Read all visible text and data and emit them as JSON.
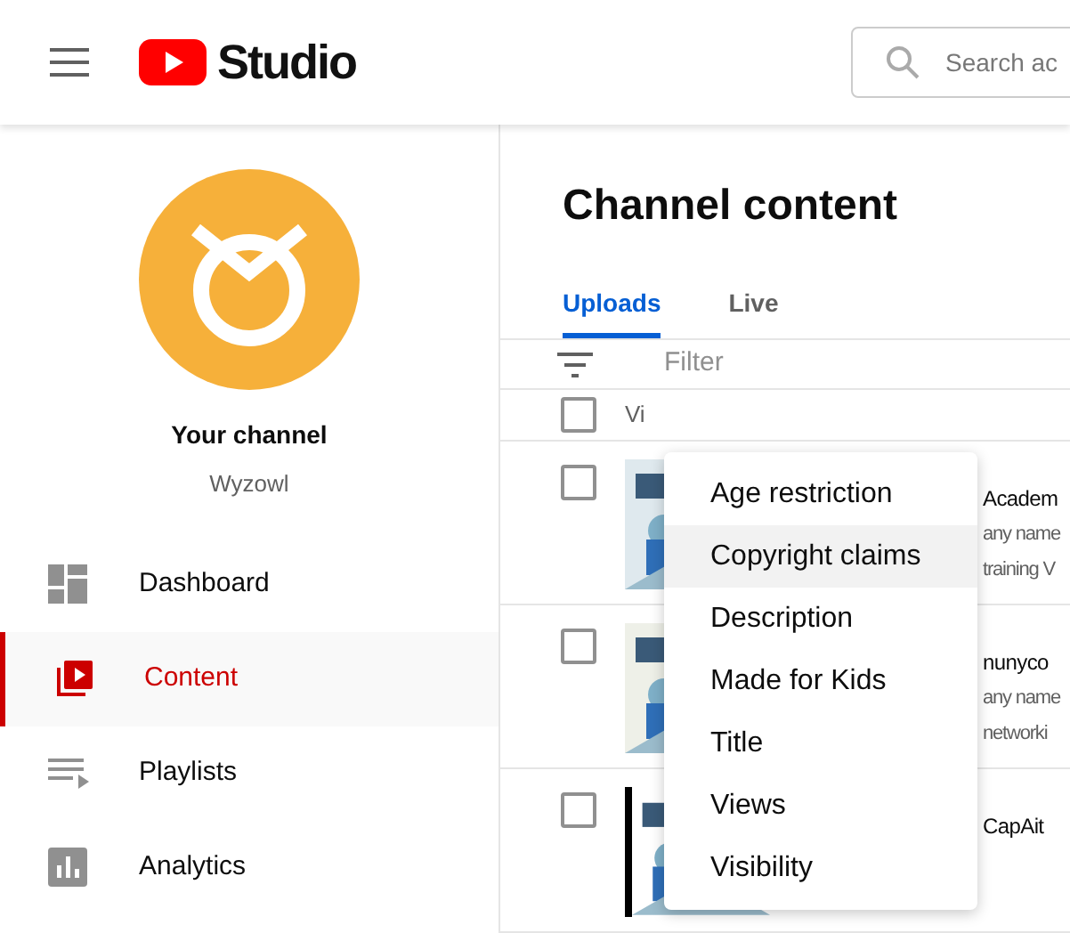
{
  "header": {
    "logo_text": "Studio",
    "search": {
      "placeholder": "Search ac"
    }
  },
  "sidebar": {
    "channel_title": "Your channel",
    "channel_name": "Wyzowl",
    "items": [
      {
        "label": "Dashboard",
        "kind": "dashboard",
        "selected": false
      },
      {
        "label": "Content",
        "kind": "content",
        "selected": true
      },
      {
        "label": "Playlists",
        "kind": "playlists",
        "selected": false
      },
      {
        "label": "Analytics",
        "kind": "analytics",
        "selected": false
      }
    ]
  },
  "main": {
    "title": "Channel content",
    "tabs": [
      {
        "label": "Uploads",
        "selected": true
      },
      {
        "label": "Live",
        "selected": false
      }
    ],
    "filter": {
      "placeholder": "Filter"
    },
    "table": {
      "header": {
        "column_1": "Vi",
        "checked": false
      },
      "rows": [
        {
          "checked": false,
          "title": "Academ",
          "lines": [
            "any name",
            "training V"
          ]
        },
        {
          "checked": false,
          "title": "nunyco",
          "lines": [
            "any name",
            "networki"
          ]
        },
        {
          "checked": false,
          "title": "CapAit",
          "lines": []
        }
      ]
    }
  },
  "filter_menu": {
    "items": [
      {
        "label": "Age restriction",
        "highlighted": false
      },
      {
        "label": "Copyright claims",
        "highlighted": true
      },
      {
        "label": "Description",
        "highlighted": false
      },
      {
        "label": "Made for Kids",
        "highlighted": false
      },
      {
        "label": "Title",
        "highlighted": false
      },
      {
        "label": "Views",
        "highlighted": false
      },
      {
        "label": "Visibility",
        "highlighted": false
      }
    ]
  }
}
